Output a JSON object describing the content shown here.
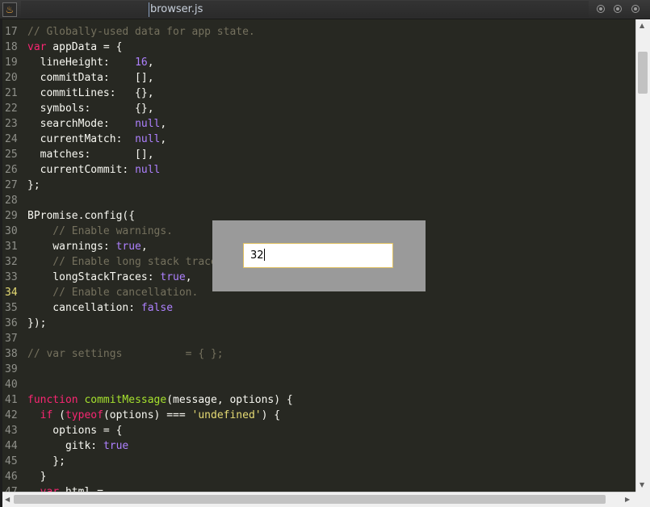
{
  "window": {
    "title": "browser.js",
    "app_icon": "flame-icon",
    "buttons": [
      "minimize-button",
      "maximize-button",
      "close-button"
    ]
  },
  "editor": {
    "active_line": 34,
    "lines": [
      {
        "no": "17",
        "tokens": [
          {
            "t": "// Globally-used data for app state.",
            "c": "c"
          }
        ]
      },
      {
        "no": "18",
        "tokens": [
          {
            "t": "var",
            "c": "k"
          },
          {
            "t": " appData = {",
            "c": ""
          }
        ]
      },
      {
        "no": "19",
        "tokens": [
          {
            "t": "  lineHeight:    ",
            "c": ""
          },
          {
            "t": "16",
            "c": "n"
          },
          {
            "t": ",",
            "c": ""
          }
        ]
      },
      {
        "no": "20",
        "tokens": [
          {
            "t": "  commitData:    [],",
            "c": ""
          }
        ]
      },
      {
        "no": "21",
        "tokens": [
          {
            "t": "  commitLines:   {},",
            "c": ""
          }
        ]
      },
      {
        "no": "22",
        "tokens": [
          {
            "t": "  symbols:       {},",
            "c": ""
          }
        ]
      },
      {
        "no": "23",
        "tokens": [
          {
            "t": "  searchMode:    ",
            "c": ""
          },
          {
            "t": "null",
            "c": "n"
          },
          {
            "t": ",",
            "c": ""
          }
        ]
      },
      {
        "no": "24",
        "tokens": [
          {
            "t": "  currentMatch:  ",
            "c": ""
          },
          {
            "t": "null",
            "c": "n"
          },
          {
            "t": ",",
            "c": ""
          }
        ]
      },
      {
        "no": "25",
        "tokens": [
          {
            "t": "  matches:       [],",
            "c": ""
          }
        ]
      },
      {
        "no": "26",
        "tokens": [
          {
            "t": "  currentCommit: ",
            "c": ""
          },
          {
            "t": "null",
            "c": "n"
          }
        ]
      },
      {
        "no": "27",
        "tokens": [
          {
            "t": "};",
            "c": ""
          }
        ]
      },
      {
        "no": "28",
        "tokens": []
      },
      {
        "no": "29",
        "tokens": [
          {
            "t": "BPromise.config({",
            "c": ""
          }
        ]
      },
      {
        "no": "30",
        "tokens": [
          {
            "t": "    // Enable warnings.",
            "c": "c"
          }
        ]
      },
      {
        "no": "31",
        "tokens": [
          {
            "t": "    warnings: ",
            "c": ""
          },
          {
            "t": "true",
            "c": "n"
          },
          {
            "t": ",",
            "c": ""
          }
        ]
      },
      {
        "no": "32",
        "tokens": [
          {
            "t": "    // Enable long stack traces.",
            "c": "c"
          }
        ]
      },
      {
        "no": "33",
        "tokens": [
          {
            "t": "    longStackTraces: ",
            "c": ""
          },
          {
            "t": "true",
            "c": "n"
          },
          {
            "t": ",",
            "c": ""
          }
        ]
      },
      {
        "no": "34",
        "tokens": [
          {
            "t": "    // Enable cancellation.",
            "c": "c"
          }
        ]
      },
      {
        "no": "35",
        "tokens": [
          {
            "t": "    cancellation: ",
            "c": ""
          },
          {
            "t": "false",
            "c": "n"
          }
        ]
      },
      {
        "no": "36",
        "tokens": [
          {
            "t": "});",
            "c": ""
          }
        ]
      },
      {
        "no": "37",
        "tokens": []
      },
      {
        "no": "38",
        "tokens": [
          {
            "t": "// var settings          = { };",
            "c": "c"
          }
        ]
      },
      {
        "no": "39",
        "tokens": []
      },
      {
        "no": "40",
        "tokens": []
      },
      {
        "no": "41",
        "tokens": [
          {
            "t": "function",
            "c": "k"
          },
          {
            "t": " ",
            "c": ""
          },
          {
            "t": "commitMessage",
            "c": "f"
          },
          {
            "t": "(message, options) {",
            "c": ""
          }
        ]
      },
      {
        "no": "42",
        "tokens": [
          {
            "t": "  ",
            "c": ""
          },
          {
            "t": "if",
            "c": "k"
          },
          {
            "t": " (",
            "c": ""
          },
          {
            "t": "typeof",
            "c": "k"
          },
          {
            "t": "(options) === ",
            "c": ""
          },
          {
            "t": "'undefined'",
            "c": "s"
          },
          {
            "t": ") {",
            "c": ""
          }
        ]
      },
      {
        "no": "43",
        "tokens": [
          {
            "t": "    options = {",
            "c": ""
          }
        ]
      },
      {
        "no": "44",
        "tokens": [
          {
            "t": "      gitk",
            "c": ""
          },
          {
            "t": ": ",
            "c": ""
          },
          {
            "t": "true",
            "c": "n"
          }
        ]
      },
      {
        "no": "45",
        "tokens": [
          {
            "t": "    };",
            "c": ""
          }
        ]
      },
      {
        "no": "46",
        "tokens": [
          {
            "t": "  }",
            "c": ""
          }
        ]
      },
      {
        "no": "47",
        "tokens": [
          {
            "t": "  ",
            "c": ""
          },
          {
            "t": "var",
            "c": "k"
          },
          {
            "t": " html = ",
            "c": ""
          }
        ]
      }
    ]
  },
  "goto_line": {
    "value": "32"
  }
}
